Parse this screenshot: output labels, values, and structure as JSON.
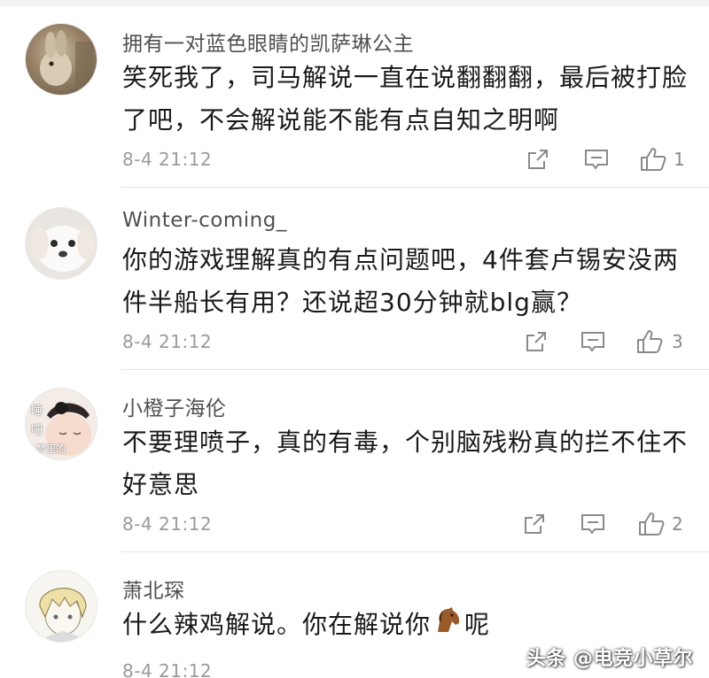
{
  "comments": [
    {
      "username": "拥有一对蓝色眼睛的凯萨琳公主",
      "text": "笑死我了，司马解说一直在说翻翻翻，最后被打脸了吧，不会解说能不能有点自知之明啊",
      "time": "8-4 21:12",
      "likes": "1",
      "avatar": "rabbit-avatar"
    },
    {
      "username": "Winter-coming_",
      "text": "你的游戏理解真的有点问题吧，4件套卢锡安没两件半船长有用？还说超30分钟就blg赢？",
      "time": "8-4 21:12",
      "likes": "3",
      "avatar": "puppy-avatar"
    },
    {
      "username": "小橙子海伦",
      "text": "不要理喷子，真的有毒，个别脑残粉真的拦不住不好意思",
      "time": "8-4 21:12",
      "likes": "2",
      "avatar": "baby-avatar",
      "avatar_text": [
        "睡",
        "吧",
        "梦里的"
      ]
    },
    {
      "username": "萧北琛",
      "text": "什么辣鸡解说。你在解说你",
      "text_suffix": "呢",
      "emoji": "horse-emoji",
      "time": "8-4 21:12",
      "likes": "",
      "avatar": "anime-boy-avatar"
    }
  ],
  "watermark": "头条 @电竞小草尔",
  "colors": {
    "text": "#1a1a1a",
    "username": "#505050",
    "meta": "#9a9a9a",
    "divider": "#e6e6e6"
  }
}
